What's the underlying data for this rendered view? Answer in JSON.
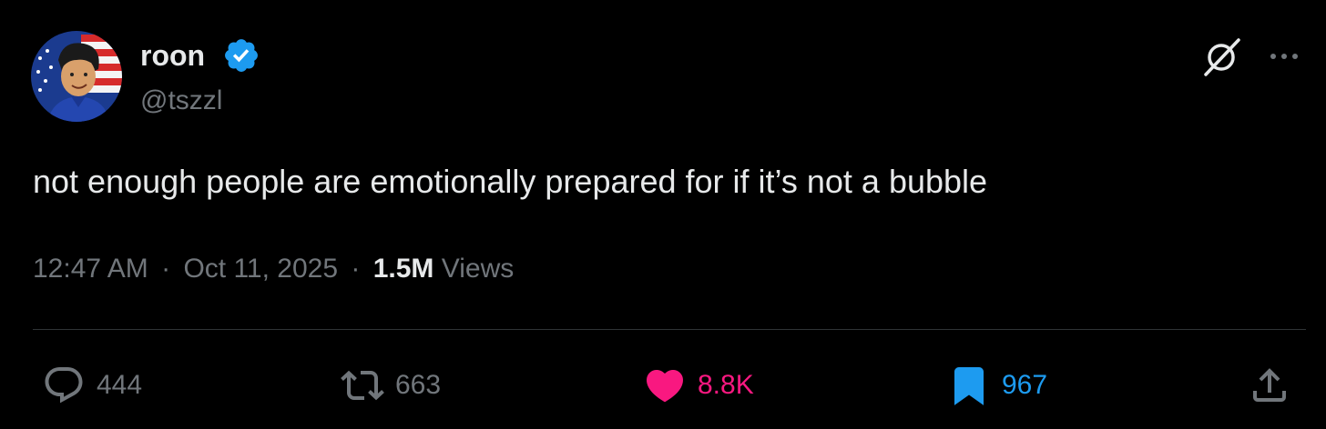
{
  "author": {
    "display_name": "roon",
    "handle": "@tszzl",
    "verified": true,
    "avatar_icon": "cartoon-avatar-with-flag"
  },
  "tweet": {
    "text": "not enough people are emotionally prepared for if it’s not a bubble",
    "time": "12:47 AM",
    "date": "Oct 11, 2025",
    "separator": "·",
    "views_count": "1.5M",
    "views_label": "Views"
  },
  "actions": {
    "reply_count": "444",
    "repost_count": "663",
    "like_count": "8.8K",
    "bookmark_count": "967"
  },
  "icons": {
    "grok": "grok-icon",
    "more": "more-icon",
    "reply": "reply-icon",
    "repost": "repost-icon",
    "like": "heart-icon",
    "bookmark": "bookmark-icon",
    "share": "share-icon"
  },
  "colors": {
    "background": "#000000",
    "text": "#e7e9ea",
    "muted": "#71767b",
    "like": "#f91880",
    "bookmark": "#1d9bf0",
    "verified": "#1d9bf0"
  }
}
